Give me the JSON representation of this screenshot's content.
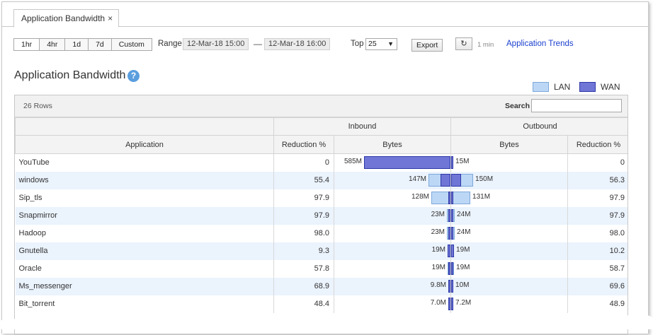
{
  "tab": {
    "label": "Application Bandwidth",
    "close": "×"
  },
  "toolbar": {
    "ranges": [
      "1hr",
      "4hr",
      "1d",
      "7d",
      "Custom"
    ],
    "range_label": "Range",
    "start": "12-Mar-18 15:00",
    "separator": "—",
    "end": "12-Mar-18 16:00",
    "top_label": "Top",
    "top_value": "25",
    "export": "Export",
    "refresh_interval": "1 min",
    "trends_link": "Application Trends"
  },
  "page": {
    "title": "Application Bandwidth",
    "help": "?"
  },
  "legend": {
    "lan": "LAN",
    "wan": "WAN",
    "lan_color": "#bcd7f5",
    "wan_color": "#6f76d6"
  },
  "grid": {
    "row_count": "26 Rows",
    "search_label": "Search",
    "group_inbound": "Inbound",
    "group_outbound": "Outbound",
    "col_application": "Application",
    "col_in_reduction": "Reduction %",
    "col_in_bytes": "Bytes",
    "col_out_bytes": "Bytes",
    "col_out_reduction": "Reduction %"
  },
  "rows": [
    {
      "app": "YouTube",
      "in_red": "0",
      "in_bytes": "585M",
      "in_lan": 585,
      "in_wan": 585,
      "out_bytes": "15M",
      "out_lan": 15,
      "out_wan": 15,
      "out_red": "0"
    },
    {
      "app": "windows",
      "in_red": "55.4",
      "in_bytes": "147M",
      "in_lan": 147,
      "in_wan": 65,
      "out_bytes": "150M",
      "out_lan": 150,
      "out_wan": 66,
      "out_red": "56.3"
    },
    {
      "app": "Sip_tls",
      "in_red": "97.9",
      "in_bytes": "128M",
      "in_lan": 128,
      "in_wan": 3,
      "out_bytes": "131M",
      "out_lan": 131,
      "out_wan": 3,
      "out_red": "97.9"
    },
    {
      "app": "Snapmirror",
      "in_red": "97.9",
      "in_bytes": "23M",
      "in_lan": 23,
      "in_wan": 0.5,
      "out_bytes": "24M",
      "out_lan": 24,
      "out_wan": 0.5,
      "out_red": "97.9"
    },
    {
      "app": "Hadoop",
      "in_red": "98.0",
      "in_bytes": "23M",
      "in_lan": 23,
      "in_wan": 0.5,
      "out_bytes": "24M",
      "out_lan": 24,
      "out_wan": 0.5,
      "out_red": "98.0"
    },
    {
      "app": "Gnutella",
      "in_red": "9.3",
      "in_bytes": "19M",
      "in_lan": 19,
      "in_wan": 17,
      "out_bytes": "19M",
      "out_lan": 19,
      "out_wan": 17,
      "out_red": "10.2"
    },
    {
      "app": "Oracle",
      "in_red": "57.8",
      "in_bytes": "19M",
      "in_lan": 19,
      "in_wan": 8,
      "out_bytes": "19M",
      "out_lan": 19,
      "out_wan": 8,
      "out_red": "58.7"
    },
    {
      "app": "Ms_messenger",
      "in_red": "68.9",
      "in_bytes": "9.8M",
      "in_lan": 9.8,
      "in_wan": 3,
      "out_bytes": "10M",
      "out_lan": 10,
      "out_wan": 3,
      "out_red": "69.6"
    },
    {
      "app": "Bit_torrent",
      "in_red": "48.4",
      "in_bytes": "7.0M",
      "in_lan": 7,
      "in_wan": 3.6,
      "out_bytes": "7.2M",
      "out_lan": 7.2,
      "out_wan": 3.7,
      "out_red": "48.9"
    }
  ]
}
